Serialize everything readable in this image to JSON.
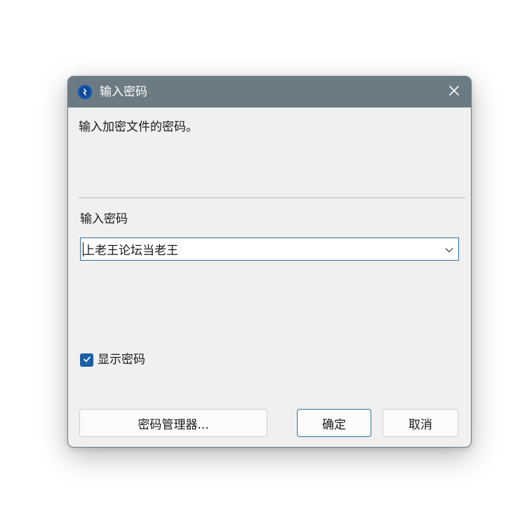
{
  "window": {
    "title": "输入密码",
    "app_icon": "bolt-icon",
    "close_icon": "close-icon"
  },
  "description": "输入加密文件的密码。",
  "password": {
    "label": "输入密码",
    "value": "上老王论坛当老王",
    "dropdown_icon": "chevron-down-icon"
  },
  "show_password": {
    "label": "显示密码",
    "checked": true
  },
  "buttons": {
    "manager": "密码管理器...",
    "ok": "确定",
    "cancel": "取消"
  },
  "colors": {
    "titlebar": "#6c7a83",
    "accent": "#1a5fa6",
    "focus_border": "#2f6d9a"
  }
}
